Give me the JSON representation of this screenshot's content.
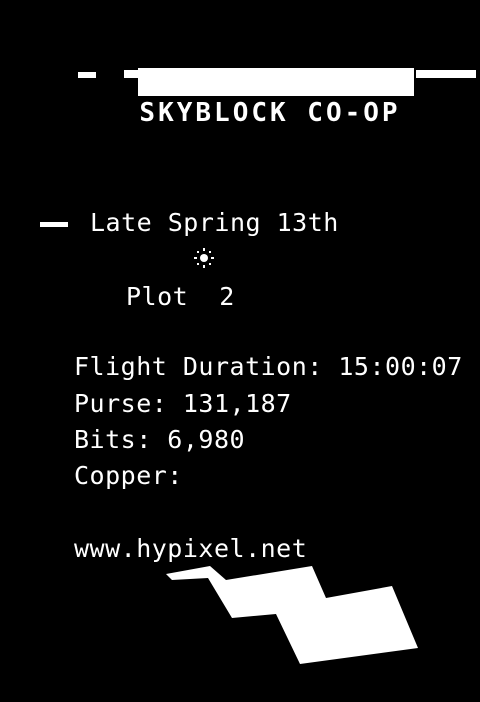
{
  "scoreboard": {
    "title": "SKYBLOCK CO-OP",
    "date": "Late Spring 13th",
    "weather_icon": "sun-icon",
    "location": "Plot  2",
    "flight_duration": "Flight Duration: 15:00:07",
    "purse": "Purse: 131,187",
    "bits": "Bits: 6,980",
    "copper": "Copper:",
    "server": "www.hypixel.net"
  },
  "colors": {
    "background": "#000000",
    "foreground": "#ffffff"
  }
}
